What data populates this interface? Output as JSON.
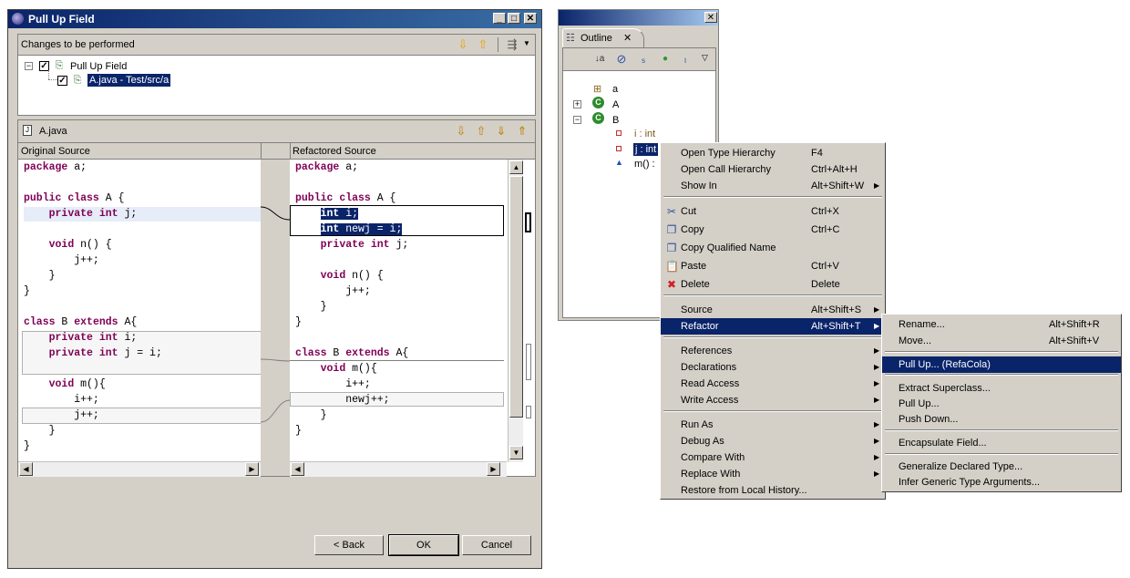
{
  "dialog": {
    "title": "Pull Up Field",
    "changes_header": "Changes to be performed",
    "tree": [
      {
        "label": "Pull Up Field"
      },
      {
        "label": "A.java - Test/src/a"
      }
    ],
    "compare_file": "A.java",
    "original_header": "Original Source",
    "refactored_header": "Refactored Source",
    "buttons": {
      "back": "< Back",
      "ok": "OK",
      "cancel": "Cancel"
    }
  },
  "original_code": [
    "package a;",
    "",
    "public class A {",
    "    private int j;",
    "",
    "    void n() {",
    "        j++;",
    "    }",
    "}",
    "",
    "class B extends A{",
    "    private int i;",
    "    private int j = i;",
    "",
    "    void m(){",
    "        i++;",
    "        j++;",
    "    }",
    "}"
  ],
  "refactored_code": [
    "package a;",
    "",
    "public class A {",
    "    int i;",
    "    int newj = i;",
    "    private int j;",
    "",
    "    void n() {",
    "        j++;",
    "    }",
    "}",
    "",
    "class B extends A{",
    "    void m(){",
    "        i++;",
    "        newj++;",
    "    }",
    "}"
  ],
  "outline": {
    "tab_label": "Outline",
    "items": [
      {
        "label": "a"
      },
      {
        "label": "A"
      },
      {
        "label": "B"
      },
      {
        "label": "i : int"
      },
      {
        "label": "j : int"
      },
      {
        "label": "m() :"
      }
    ]
  },
  "context_menu": {
    "items": [
      {
        "label": "Open Type Hierarchy",
        "accel": "F4"
      },
      {
        "label": "Open Call Hierarchy",
        "accel": "Ctrl+Alt+H"
      },
      {
        "label": "Show In",
        "accel": "Alt+Shift+W"
      },
      {
        "label": "Cut",
        "accel": "Ctrl+X"
      },
      {
        "label": "Copy",
        "accel": "Ctrl+C"
      },
      {
        "label": "Copy Qualified Name",
        "accel": ""
      },
      {
        "label": "Paste",
        "accel": "Ctrl+V"
      },
      {
        "label": "Delete",
        "accel": "Delete"
      },
      {
        "label": "Source",
        "accel": "Alt+Shift+S"
      },
      {
        "label": "Refactor",
        "accel": "Alt+Shift+T"
      },
      {
        "label": "References",
        "accel": ""
      },
      {
        "label": "Declarations",
        "accel": ""
      },
      {
        "label": "Read Access",
        "accel": ""
      },
      {
        "label": "Write Access",
        "accel": ""
      },
      {
        "label": "Run As",
        "accel": ""
      },
      {
        "label": "Debug As",
        "accel": ""
      },
      {
        "label": "Compare With",
        "accel": ""
      },
      {
        "label": "Replace With",
        "accel": ""
      },
      {
        "label": "Restore from Local History...",
        "accel": ""
      }
    ]
  },
  "refactor_menu": {
    "items": [
      {
        "label": "Rename...",
        "accel": "Alt+Shift+R"
      },
      {
        "label": "Move...",
        "accel": "Alt+Shift+V"
      },
      {
        "label": "Pull Up... (RefaCola)",
        "accel": ""
      },
      {
        "label": "Extract Superclass...",
        "accel": ""
      },
      {
        "label": "Pull Up...",
        "accel": ""
      },
      {
        "label": "Push Down...",
        "accel": ""
      },
      {
        "label": "Encapsulate Field...",
        "accel": ""
      },
      {
        "label": "Generalize Declared Type...",
        "accel": ""
      },
      {
        "label": "Infer Generic Type Arguments...",
        "accel": ""
      }
    ]
  }
}
